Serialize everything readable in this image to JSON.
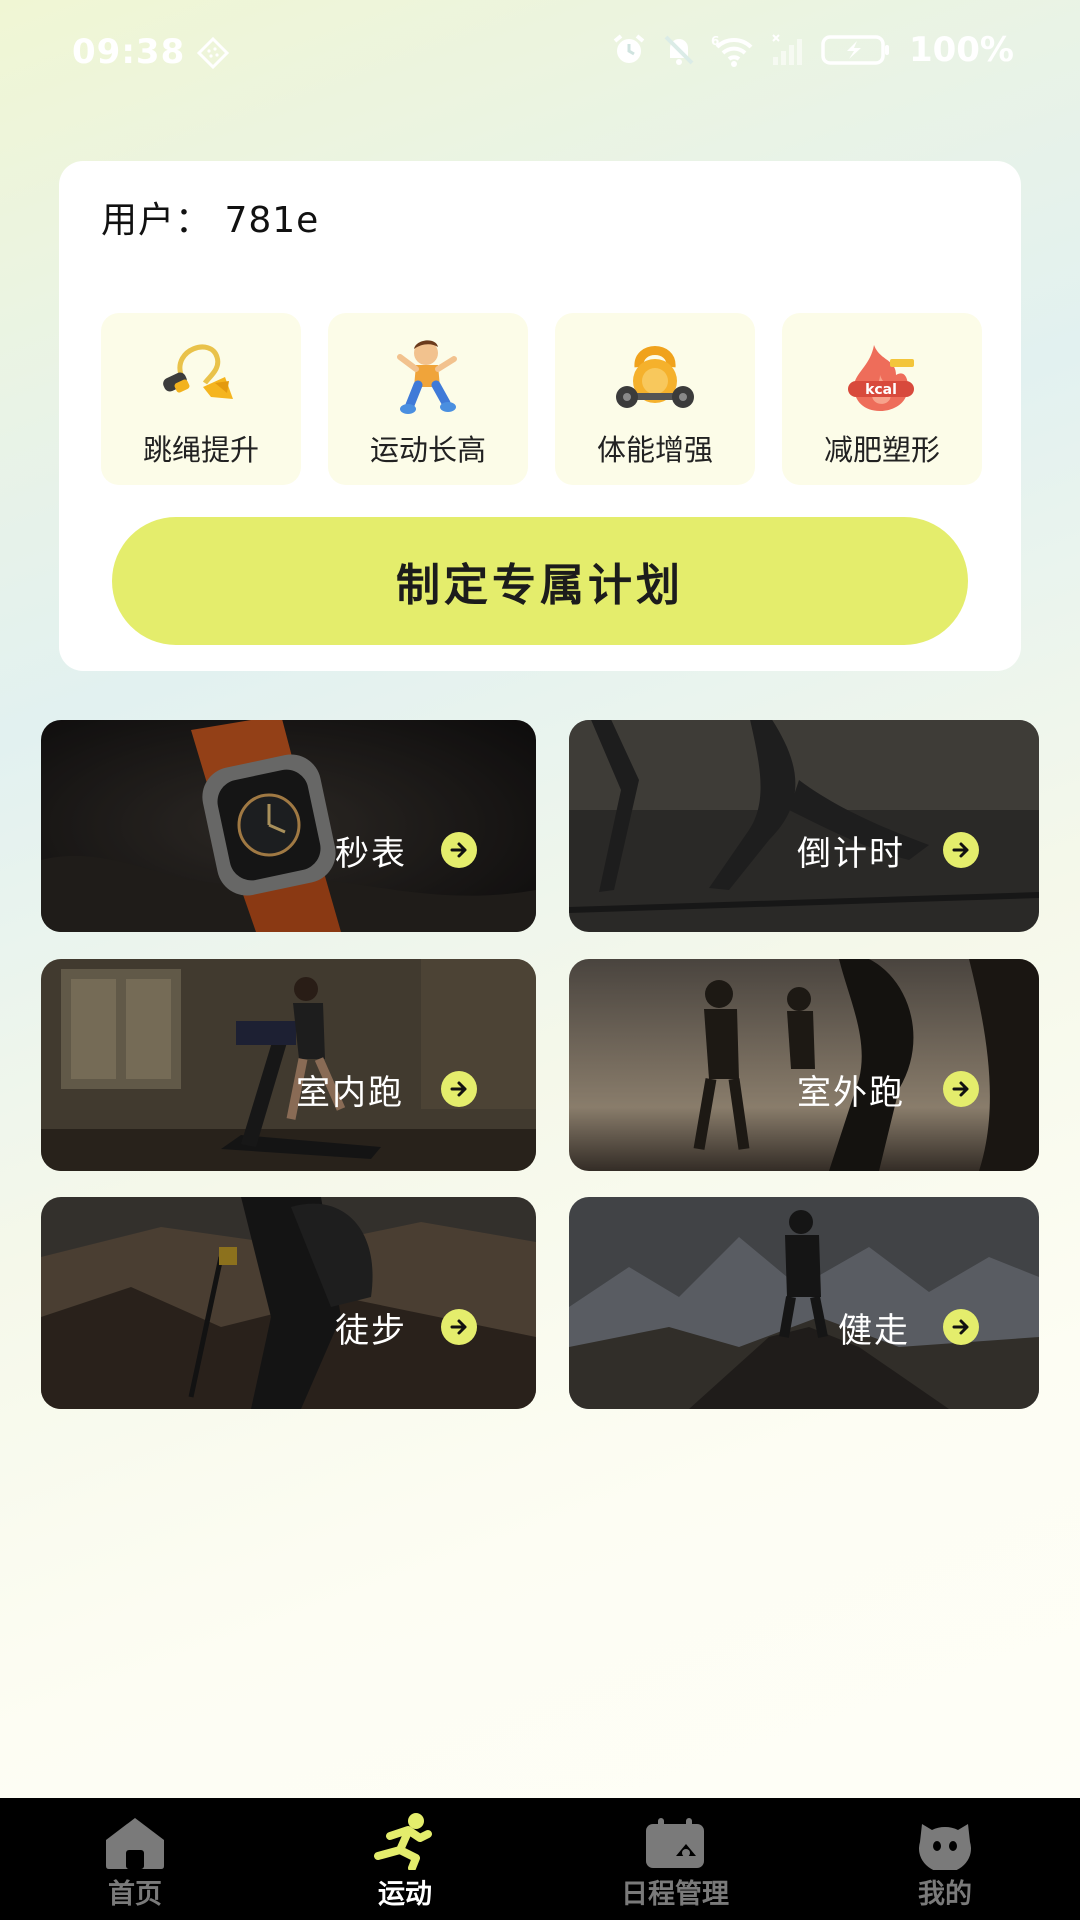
{
  "status_bar": {
    "time": "09:38",
    "battery": "100%",
    "signal_label": "6"
  },
  "card": {
    "user_label": "用户：  781e",
    "goals": [
      {
        "label": "跳绳提升",
        "icon": "jump-rope-icon"
      },
      {
        "label": "运动长高",
        "icon": "jumping-kid-icon"
      },
      {
        "label": "体能增强",
        "icon": "kettlebell-icon"
      },
      {
        "label": "减肥塑形",
        "icon": "kcal-flame-icon"
      }
    ],
    "goal_kcal_text": "kcal",
    "plan_button": "制定专属计划"
  },
  "activities": [
    {
      "label": "秒表"
    },
    {
      "label": "倒计时"
    },
    {
      "label": "室内跑"
    },
    {
      "label": "室外跑"
    },
    {
      "label": "徒步"
    },
    {
      "label": "健走"
    }
  ],
  "nav": [
    {
      "label": "首页",
      "icon": "home-icon"
    },
    {
      "label": "运动",
      "icon": "running-person-icon"
    },
    {
      "label": "日程管理",
      "icon": "calendar-icon"
    },
    {
      "label": "我的",
      "icon": "profile-face-icon"
    }
  ],
  "colors": {
    "accent": "#e4ed6c",
    "nav_bg": "#000000",
    "card_bg": "#ffffff",
    "goal_tile_bg": "#fcfce8"
  }
}
